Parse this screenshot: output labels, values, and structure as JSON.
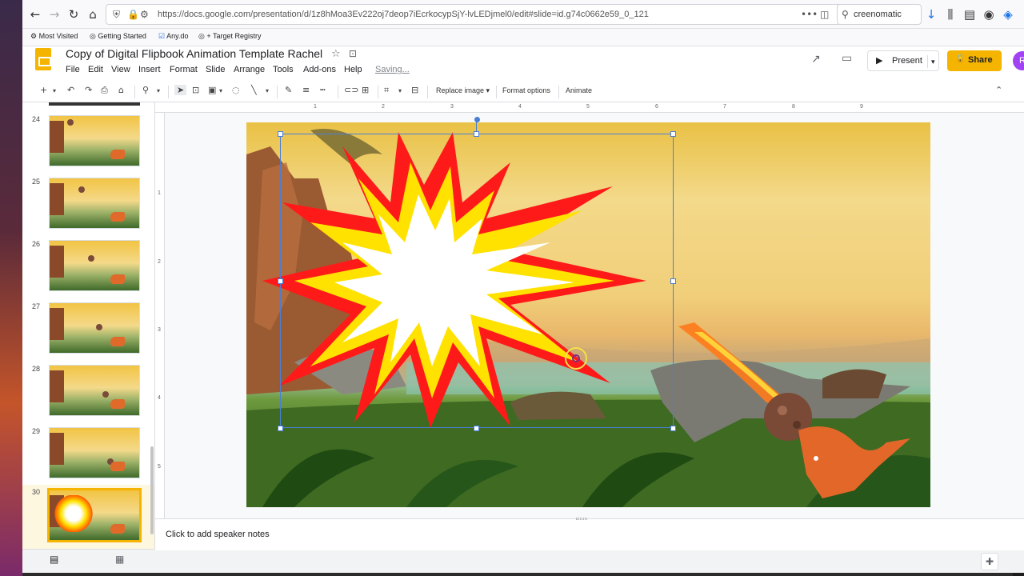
{
  "browser": {
    "url": "https://docs.google.com/presentation/d/1z8hMoa3Ev222oj7deop7iEcrkocypSjY-lvLEDjmel0/edit#slide=id.g74c0662e59_0_121",
    "search": "creenomatic",
    "bookmarks": [
      "Most Visited",
      "Getting Started",
      "Any.do",
      "+ Target Registry"
    ]
  },
  "doc": {
    "title": "Copy of Digital Flipbook Animation Template Rachel",
    "menus": [
      "File",
      "Edit",
      "View",
      "Insert",
      "Format",
      "Slide",
      "Arrange",
      "Tools",
      "Add-ons",
      "Help"
    ],
    "status": "Saving...",
    "present_label": "Present",
    "share_label": "Share",
    "avatar_letter": "R"
  },
  "toolbar": {
    "replace_image": "Replace image",
    "format_options": "Format options",
    "animate": "Animate"
  },
  "filmstrip": {
    "slides": [
      {
        "num": "24"
      },
      {
        "num": "25"
      },
      {
        "num": "26"
      },
      {
        "num": "27"
      },
      {
        "num": "28"
      },
      {
        "num": "29"
      },
      {
        "num": "30"
      }
    ],
    "selected": "30"
  },
  "rulers": {
    "top": [
      "1",
      "1",
      "2",
      "3",
      "4",
      "5",
      "6",
      "7",
      "8",
      "9"
    ],
    "left": [
      "1",
      "2",
      "3",
      "4",
      "5"
    ]
  },
  "notes": {
    "placeholder": "Click to add speaker notes"
  },
  "colors": {
    "accent": "#f4b400",
    "selection": "#4a7fd6"
  }
}
